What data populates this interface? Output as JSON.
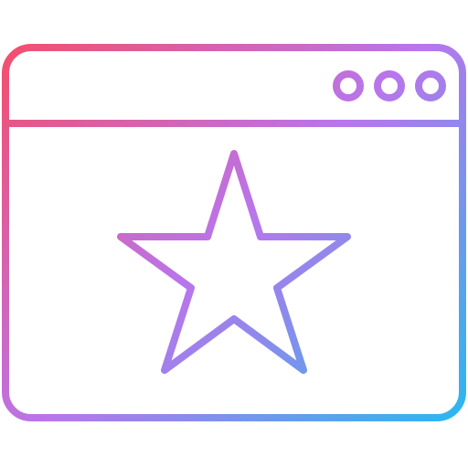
{
  "icon": {
    "name": "browser-window-star-icon",
    "gradient": {
      "start": "#fb4a5d",
      "middle": "#b975ec",
      "end": "#18c1ee"
    },
    "window_controls": [
      "dot-icon",
      "dot-icon",
      "dot-icon"
    ],
    "content_icon": "star-icon"
  }
}
